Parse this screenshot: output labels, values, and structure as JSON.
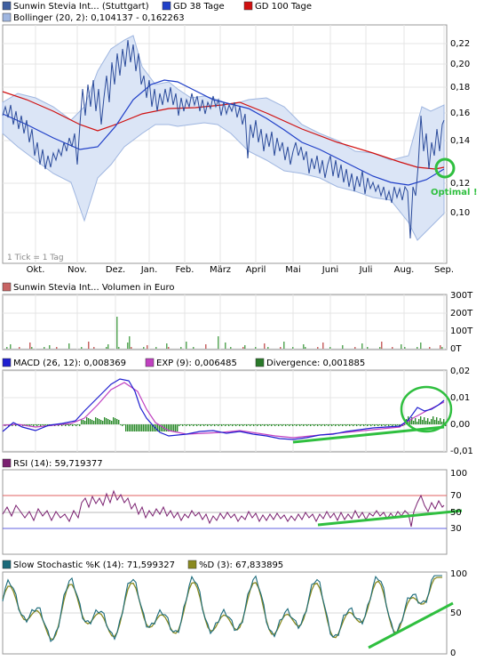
{
  "chart_data": [
    {
      "type": "line",
      "panel": "price",
      "legend": [
        {
          "label": "Sunwin Stevia Int... (Stuttgart)",
          "color": "#3f5fa0"
        },
        {
          "label": "GD 38 Tage",
          "color": "#1f3fc8"
        },
        {
          "label": "GD 100 Tage",
          "color": "#d01010"
        },
        {
          "label": "Bollinger (20, 2): 0,104137 - 0,162263",
          "color": "#9fb6e0"
        }
      ],
      "x_ticks": [
        "Okt.",
        "Nov.",
        "Dez.",
        "Jan.",
        "Feb.",
        "März",
        "April",
        "Mai",
        "Juni",
        "Juli",
        "Aug.",
        "Sep."
      ],
      "y_ticks": [
        "0,10",
        "0,12",
        "0,14",
        "0,16",
        "0,18",
        "0,20",
        "0,22"
      ],
      "ylim": [
        0.08,
        0.23
      ],
      "tick_note": "1 Tick = 1 Tag",
      "annotation": "Optimal !",
      "series": [
        {
          "name": "Sunwin Stevia Int... (Stuttgart)",
          "values": [
            0.155,
            0.15,
            0.16,
            0.145,
            0.125,
            0.12,
            0.14,
            0.165,
            0.16,
            0.175,
            0.185,
            0.215,
            0.2,
            0.19,
            0.18,
            0.175,
            0.168,
            0.162,
            0.17,
            0.168,
            0.165,
            0.16,
            0.14,
            0.15,
            0.138,
            0.142,
            0.13,
            0.125,
            0.122,
            0.118,
            0.115,
            0.11,
            0.105,
            0.128,
            0.15,
            0.155
          ]
        },
        {
          "name": "GD 38 Tage",
          "values": [
            0.15,
            0.145,
            0.138,
            0.135,
            0.136,
            0.15,
            0.17,
            0.182,
            0.185,
            0.175,
            0.168,
            0.165,
            0.162,
            0.158,
            0.15,
            0.145,
            0.14,
            0.136,
            0.13,
            0.125,
            0.12,
            0.115,
            0.112,
            0.113,
            0.12
          ]
        },
        {
          "name": "GD 100 Tage",
          "values": [
            0.175,
            0.168,
            0.158,
            0.148,
            0.145,
            0.15,
            0.158,
            0.162,
            0.165,
            0.166,
            0.165,
            0.16,
            0.155,
            0.15,
            0.145,
            0.14,
            0.135,
            0.128,
            0.124,
            0.122
          ]
        }
      ]
    },
    {
      "type": "bar",
      "panel": "volume",
      "legend": [
        {
          "label": "Sunwin Stevia Int... Volumen in Euro",
          "color": "#c86464"
        }
      ],
      "y_ticks": [
        "0T",
        "100T",
        "200T",
        "300T"
      ]
    },
    {
      "type": "line",
      "panel": "macd",
      "legend": [
        {
          "label": "MACD (26, 12): 0,008369",
          "color": "#1f1fd0"
        },
        {
          "label": "EXP (9): 0,006485",
          "color": "#c040c0"
        },
        {
          "label": "Divergence: 0,001885",
          "color": "#2a7a2a"
        }
      ],
      "y_ticks": [
        "-0,01",
        "0,00",
        "0,01",
        "0,02"
      ]
    },
    {
      "type": "line",
      "panel": "rsi",
      "legend": [
        {
          "label": "RSI (14): 59,719377",
          "color": "#7a2070"
        }
      ],
      "y_ticks": [
        "30",
        "50",
        "70",
        "100"
      ]
    },
    {
      "type": "line",
      "panel": "stochastic",
      "legend": [
        {
          "label": "Slow Stochastic %K (14): 71,599327",
          "color": "#1a6a7a"
        },
        {
          "label": "%D (3): 67,833895",
          "color": "#8a8a20"
        }
      ],
      "y_ticks": [
        "0",
        "50",
        "100"
      ]
    }
  ]
}
